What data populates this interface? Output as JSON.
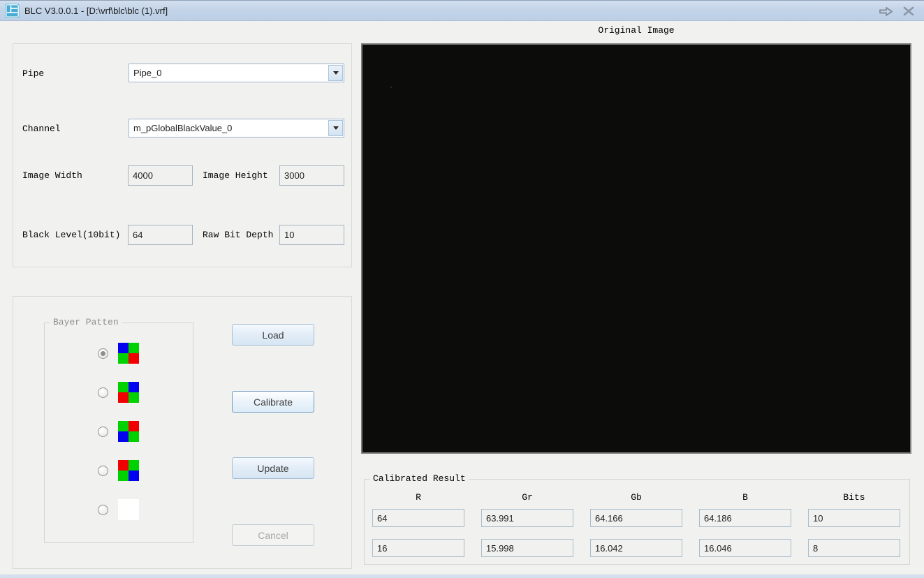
{
  "window": {
    "title": "BLC V3.0.0.1 - [D:\\vrf\\blc\\blc (1).vrf]"
  },
  "params": {
    "pipe_label": "Pipe",
    "pipe_value": "Pipe_0",
    "channel_label": "Channel",
    "channel_value": "m_pGlobalBlackValue_0",
    "image_width_label": "Image Width",
    "image_width_value": "4000",
    "image_height_label": "Image Height",
    "image_height_value": "3000",
    "black_level_label": "Black Level(10bit)",
    "black_level_value": "64",
    "raw_bit_depth_label": "Raw Bit Depth",
    "raw_bit_depth_value": "10"
  },
  "bayer": {
    "legend": "Bayer Patten",
    "options": [
      {
        "name": "BGGR",
        "selected": true,
        "cells": [
          "#0202f0",
          "#00d200",
          "#00d200",
          "#f00000"
        ]
      },
      {
        "name": "GBRG",
        "selected": false,
        "cells": [
          "#00d200",
          "#0202f0",
          "#f00000",
          "#00d200"
        ]
      },
      {
        "name": "GRBG",
        "selected": false,
        "cells": [
          "#00d200",
          "#f00000",
          "#0202f0",
          "#00d200"
        ]
      },
      {
        "name": "RGGB",
        "selected": false,
        "cells": [
          "#f00000",
          "#00d200",
          "#00d200",
          "#0202f0"
        ]
      },
      {
        "name": "MONO",
        "selected": false,
        "cells": [
          "#ffffff",
          "#ffffff",
          "#ffffff",
          "#ffffff"
        ]
      }
    ]
  },
  "actions": {
    "load": "Load",
    "calibrate": "Calibrate",
    "update": "Update",
    "cancel": "Cancel"
  },
  "image_panel": {
    "title": "Original Image"
  },
  "result": {
    "legend": "Calibrated Result",
    "columns": [
      "R",
      "Gr",
      "Gb",
      "B",
      "Bits"
    ],
    "rows": [
      [
        "64",
        "63.991",
        "64.166",
        "64.186",
        "10"
      ],
      [
        "16",
        "15.998",
        "16.042",
        "16.046",
        "8"
      ]
    ]
  }
}
